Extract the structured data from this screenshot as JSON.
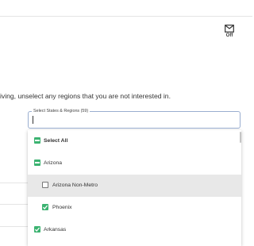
{
  "toolbar": {
    "mail_label": "Off"
  },
  "instructions": "iving, unselect any regions that you are not interested in.",
  "region_select": {
    "legend": "Select States & Regions (59)",
    "value": "",
    "options": [
      {
        "label": "Select All",
        "state": "partial",
        "bold": true
      },
      {
        "label": "Arizona",
        "state": "partial",
        "bold": false
      },
      {
        "label": "Arizona Non-Metro",
        "state": "unchecked",
        "bold": false
      },
      {
        "label": "Phoenix",
        "state": "checked",
        "bold": false
      },
      {
        "label": "Arkansas",
        "state": "checked",
        "bold": false
      }
    ]
  },
  "colors": {
    "checkbox": "#3cb371",
    "field_border": "#9aaed0",
    "hover_row": "#e8e8e8"
  }
}
